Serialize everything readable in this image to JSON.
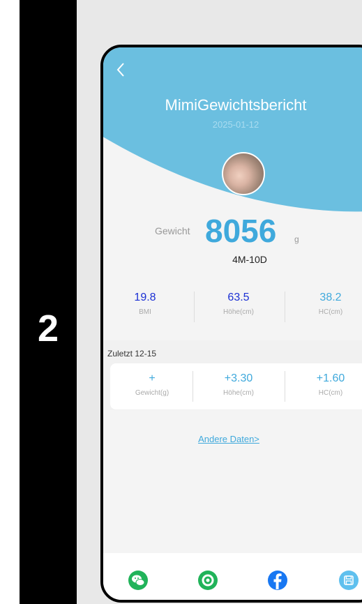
{
  "step": "2",
  "header": {
    "back_icon": "chevron-left-icon",
    "title": "MimiGewichtsbericht",
    "date": "2025-01-12"
  },
  "weight": {
    "label": "Gewicht",
    "value": "8056",
    "unit": "g",
    "age": "4M-10D"
  },
  "stats": [
    {
      "value": "19.8",
      "label": "BMI",
      "color": "#1a2fd4"
    },
    {
      "value": "63.5",
      "label": "Höhe(cm)",
      "color": "#1a2fd4"
    },
    {
      "value": "38.2",
      "label": "HC(cm)",
      "color": "#3fa9dc"
    }
  ],
  "last": {
    "label": "Zuletzt  12-15",
    "items": [
      {
        "value": "+",
        "label": "Gewicht(g)"
      },
      {
        "value": "+3.30",
        "label": "Höhe(cm)"
      },
      {
        "value": "+1.60",
        "label": "HC(cm)"
      }
    ]
  },
  "more_link": "Andere Daten>",
  "share": [
    {
      "icon": "wechat-icon",
      "color": "#21b35a"
    },
    {
      "icon": "moments-icon",
      "color": "#21b35a"
    },
    {
      "icon": "facebook-icon",
      "color": "#1877f2"
    },
    {
      "icon": "save-icon",
      "color": "#5fc0ee"
    }
  ],
  "colors": {
    "header": "#6bbfe0",
    "accent": "#3fa9dc"
  }
}
